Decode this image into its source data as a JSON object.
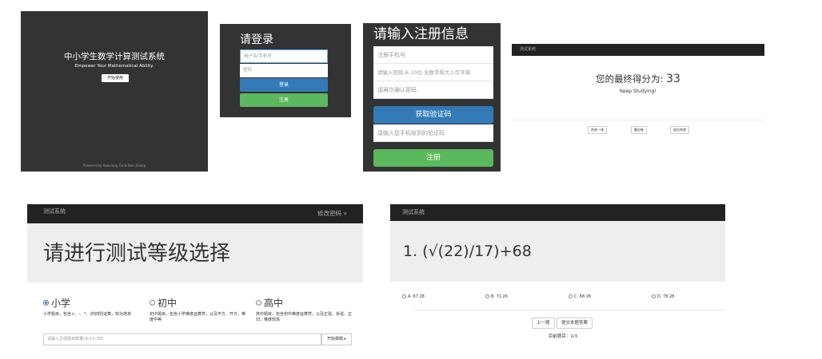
{
  "splash": {
    "title": "中小学生数学计算测试系统",
    "subtitle": "Empower Your Mathematical Ability.",
    "start_button": "开始使用",
    "footer": "Powered by Huaxiang Fie & Nan Zhang"
  },
  "login": {
    "heading": "请登录",
    "username_placeholder": "用户名/手机号",
    "password_placeholder": "密码",
    "login_button": "登录",
    "register_button": "注册"
  },
  "register": {
    "heading": "请输入注册信息",
    "phone_placeholder": "注册手机号",
    "password_placeholder": "请输入密码,6-10位,含数字和大小写字母",
    "confirm_placeholder": "请再次确认密码",
    "get_code_button": "获取验证码",
    "code_placeholder": "请输入您手机收到的验证码",
    "register_button": "注册"
  },
  "result": {
    "nav_brand": "测试系统",
    "score_label": "您的最终得分为:",
    "score_value": "33",
    "message": "Keep Studying!",
    "buttons": [
      "再来一张",
      "重出卷",
      "退出系统"
    ]
  },
  "level_select": {
    "nav_brand": "测试系统",
    "change_password": "修改密码 »",
    "title": "请进行测试等级选择",
    "options": [
      {
        "label": "小学",
        "selected": true,
        "desc": "小学题目，包含+、-、*、/的四则运算，较为简单"
      },
      {
        "label": "初中",
        "selected": false,
        "desc": "初中题目，包含小学难度运算符，以及平方、开方，难度中等"
      },
      {
        "label": "高中",
        "selected": false,
        "desc": "高中题目，包含初中难度运算符，以及正弦、余弦、正切，难度较高"
      }
    ],
    "count_placeholder": "请输入生成题目数量(大小1-30)",
    "start_button": "开始做题 ▸"
  },
  "question": {
    "nav_brand": "测试系统",
    "text": "1. (√(22)/17)+68",
    "choices": [
      "A. 67.28",
      "B. 71.26",
      "C. 68.26",
      "D. 78.28"
    ],
    "prev_button": "上一题",
    "submit_button": "提交本题答案",
    "current_label": "目前题目：1/3"
  }
}
